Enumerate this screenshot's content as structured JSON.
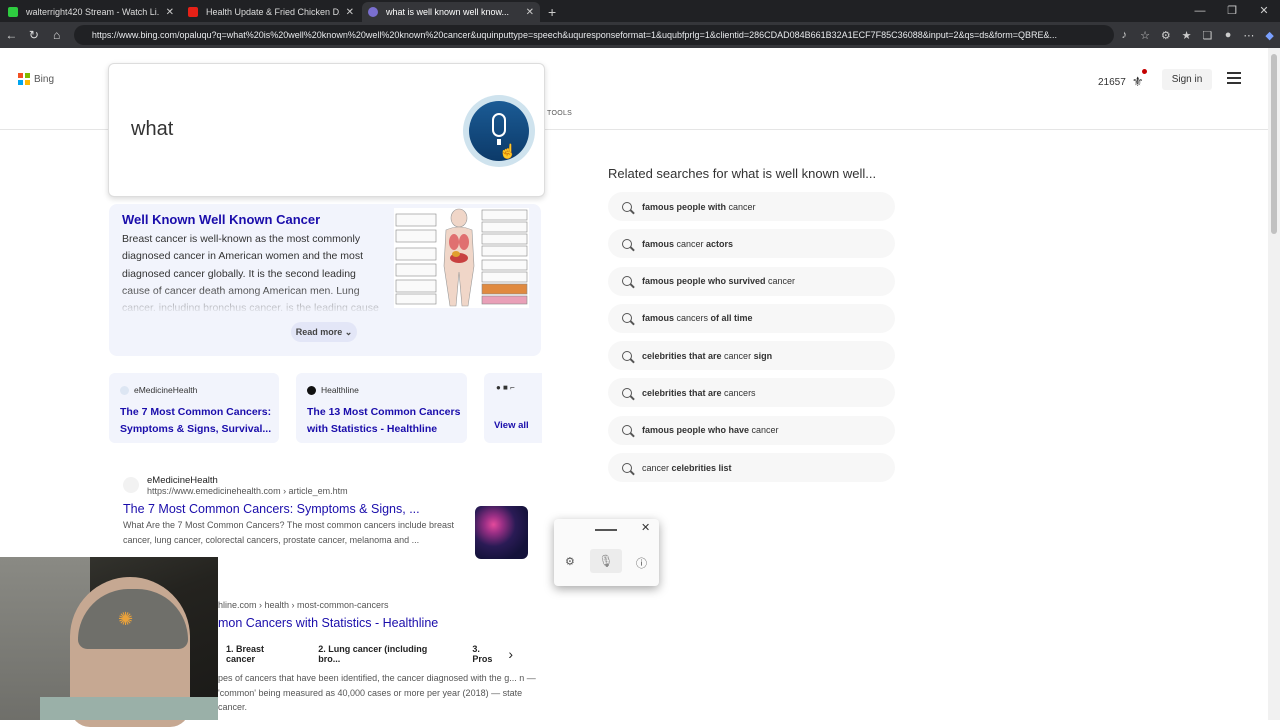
{
  "browser": {
    "tabs": [
      {
        "title": "walterright420 Stream - Watch Li...",
        "color": "#2ecc40",
        "active": false
      },
      {
        "title": "Health Update & Fried Chicken D...",
        "color": "#e62117",
        "active": false
      },
      {
        "title": "what is well known well know...",
        "color": "#7a6fd0",
        "active": true
      }
    ],
    "new_tab": "+",
    "url": "https://www.bing.com/opaluqu?q=what%20is%20well%20known%20well%20known%20cancer&uquinputtype=speech&uquresponseformat=1&uqubfprlg=1&clientid=286CDAD084B661B32A1ECF7F85C36088&input=2&qs=ds&form=QBRE&..."
  },
  "header": {
    "logo_text": "Bing",
    "tools": "TOOLS",
    "rewards_count": "21657",
    "signin": "Sign in"
  },
  "voice": {
    "recognized_text": "what"
  },
  "answer": {
    "title": "Well Known Well Known Cancer",
    "body": "Breast cancer is well-known as the most commonly diagnosed cancer in American women and the most diagnosed cancer globally. It is the second leading cause of cancer death among American men. Lung cancer, including bronchus cancer, is the leading cause",
    "read_more": "Read more"
  },
  "cards": [
    {
      "source": "eMedicineHealth",
      "title": "The 7 Most Common Cancers: Symptoms & Signs, Survival..."
    },
    {
      "source": "Healthline",
      "title": "The 13 Most Common Cancers with Statistics - Healthline"
    }
  ],
  "view_all": "View all",
  "results": [
    {
      "site": "eMedicineHealth",
      "url": "https://www.emedicinehealth.com › article_em.htm",
      "title": "The 7 Most Common Cancers: Symptoms & Signs, ...",
      "snippet": "What Are the 7 Most Common Cancers? The most common cancers include breast cancer, lung cancer, colorectal cancers, prostate cancer, melanoma and ..."
    },
    {
      "url": "hline.com › health › most-common-cancers",
      "title": "mon Cancers with Statistics - Healthline",
      "tabs": [
        "1. Breast cancer",
        "2. Lung cancer (including bro...",
        "3. Pros"
      ],
      "snippet": "pes of cancers that have been identified, the cancer diagnosed with the g... n — 'common' being measured as 40,000 cases or more per year (2018) — state cancer."
    }
  ],
  "related": {
    "heading": "Related searches for what is well known well...",
    "items": [
      {
        "parts": [
          [
            "famous people with",
            true
          ],
          [
            " cancer",
            false
          ]
        ]
      },
      {
        "parts": [
          [
            "famous",
            true
          ],
          [
            " cancer ",
            false
          ],
          [
            "actors",
            true
          ]
        ]
      },
      {
        "parts": [
          [
            "famous people who survived",
            true
          ],
          [
            " cancer",
            false
          ]
        ]
      },
      {
        "parts": [
          [
            "famous",
            true
          ],
          [
            " cancers ",
            false
          ],
          [
            "of all time",
            true
          ]
        ]
      },
      {
        "parts": [
          [
            "celebrities that are",
            true
          ],
          [
            " cancer ",
            false
          ],
          [
            "sign",
            true
          ]
        ]
      },
      {
        "parts": [
          [
            "celebrities that are",
            true
          ],
          [
            " cancers",
            false
          ]
        ]
      },
      {
        "parts": [
          [
            "famous people who have",
            true
          ],
          [
            " cancer",
            false
          ]
        ]
      },
      {
        "parts": [
          [
            "cancer ",
            false
          ],
          [
            "celebrities list",
            true
          ]
        ]
      }
    ]
  },
  "icons": {
    "mic": "microphone-icon",
    "settings": "gear-icon",
    "help": "help-icon",
    "close": "close-icon"
  }
}
